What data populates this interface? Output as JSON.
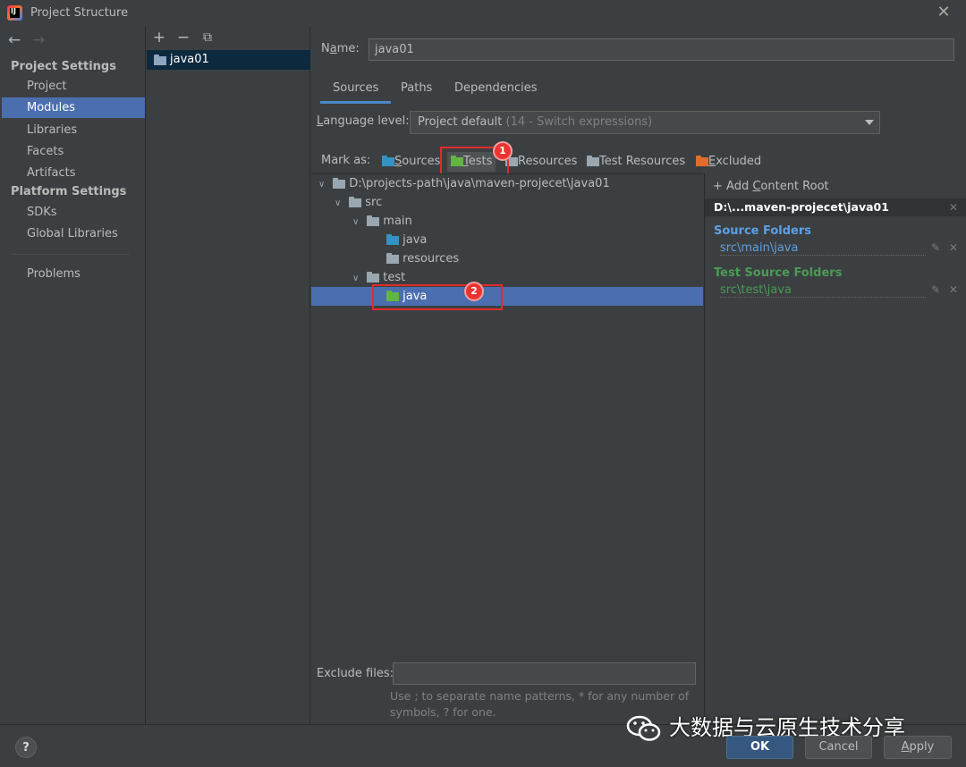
{
  "window": {
    "title": "Project Structure"
  },
  "nav": {
    "project_settings": "Project Settings",
    "project": "Project",
    "modules": "Modules",
    "libraries": "Libraries",
    "facets": "Facets",
    "artifacts": "Artifacts",
    "platform_settings": "Platform Settings",
    "sdks": "SDKs",
    "global_libraries": "Global Libraries",
    "problems": "Problems"
  },
  "modules": {
    "items": [
      "java01"
    ]
  },
  "module": {
    "name_label_prefix": "N",
    "name_label_underlined": "a",
    "name_label_suffix": "me:",
    "name_value": "java01",
    "tabs": [
      "Sources",
      "Paths",
      "Dependencies"
    ],
    "active_tab": "Sources",
    "language_label_underlined": "L",
    "language_label_rest": "anguage level:",
    "language_value": "Project default",
    "language_hint": "(14 - Switch expressions)",
    "mark_as_label": "Mark as:",
    "mark_buttons": {
      "sources_underlined": "S",
      "sources_rest": "ources",
      "tests_underlined": "T",
      "tests_rest": "ests",
      "resources": "Resources",
      "test_resources": "Test Resources",
      "excluded_underlined": "E",
      "excluded_rest": "xcluded"
    },
    "tree": {
      "root": "D:\\projects-path\\java\\maven-projecet\\java01",
      "src": "src",
      "main": "main",
      "main_java": "java",
      "resources": "resources",
      "test": "test",
      "test_java": "java"
    },
    "exclude_label": "Exclude files:",
    "exclude_value": "",
    "help_line1": "Use ; to separate name patterns, * for any number of",
    "help_line2": "symbols, ? for one."
  },
  "content_root": {
    "add_prefix": "+ Add ",
    "add_underlined": "C",
    "add_rest": "ontent Root",
    "root_path": "D:\\...maven-projecet\\java01",
    "source_folders_title": "Source Folders",
    "source_folder": "src\\main\\java",
    "test_source_folders_title": "Test Source Folders",
    "test_source_folder": "src\\test\\java"
  },
  "annotations": {
    "badge1": "1",
    "badge2": "2"
  },
  "buttons": {
    "help": "?",
    "ok": "OK",
    "cancel": "Cancel",
    "apply_underlined": "A",
    "apply_rest": "pply"
  },
  "watermark": {
    "text": "大数据与云原生技术分享"
  },
  "colors": {
    "background": "#3c3f41",
    "selection": "#4b6eaf",
    "source_blue": "#5c9fe3",
    "test_green": "#499c54",
    "callout_red": "#e02b2b"
  }
}
